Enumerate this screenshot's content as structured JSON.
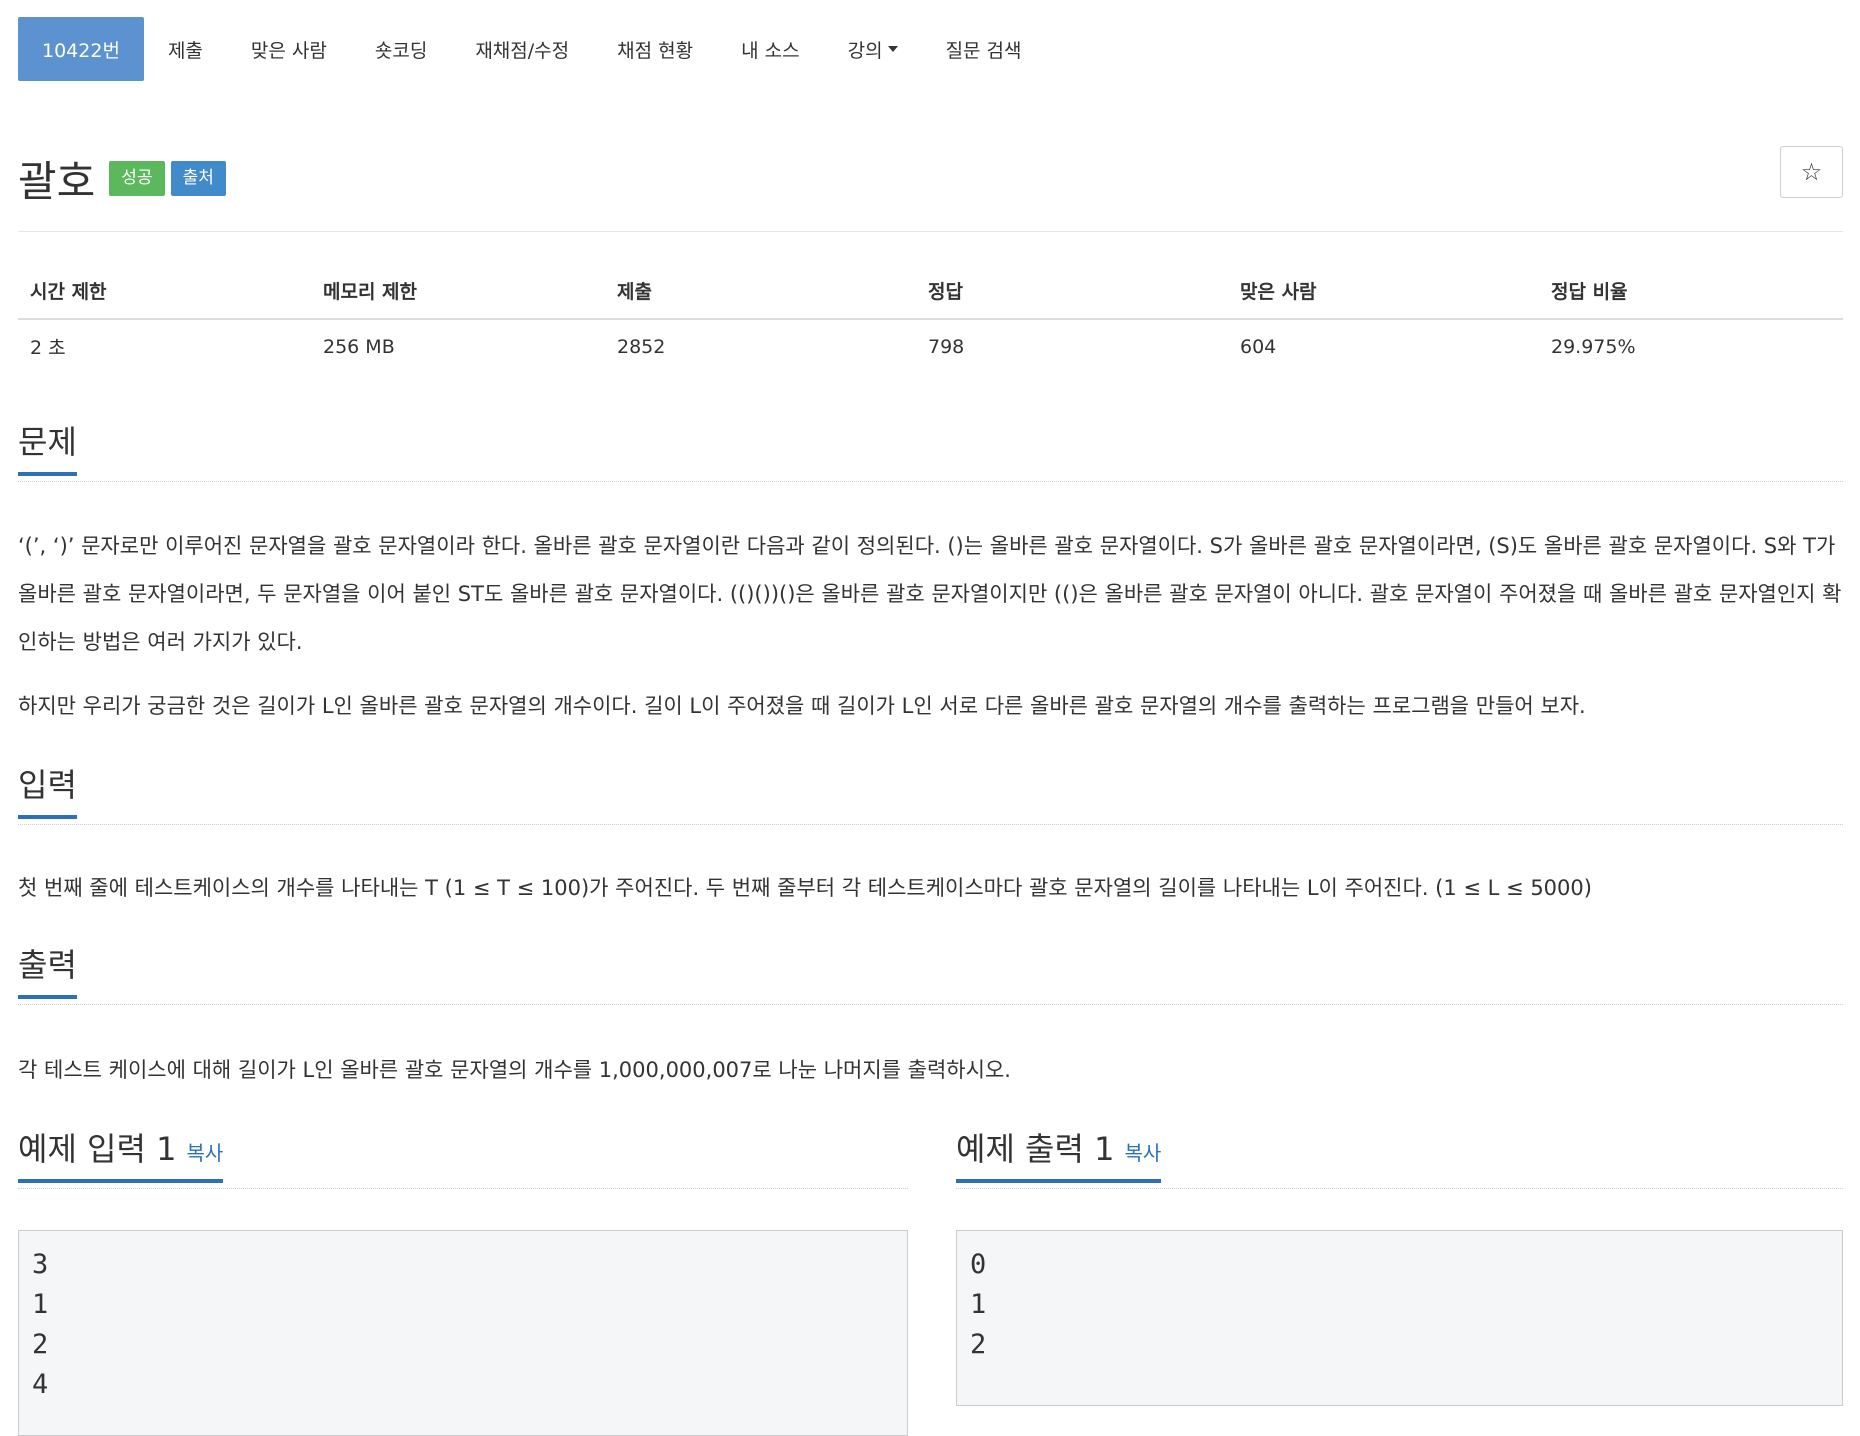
{
  "nav": {
    "items": [
      {
        "label": "10422번",
        "active": true
      },
      {
        "label": "제출"
      },
      {
        "label": "맞은 사람"
      },
      {
        "label": "숏코딩"
      },
      {
        "label": "재채점/수정"
      },
      {
        "label": "채점 현황"
      },
      {
        "label": "내 소스"
      },
      {
        "label": "강의",
        "dropdown": true
      },
      {
        "label": "질문 검색"
      }
    ]
  },
  "problem": {
    "title": "괄호",
    "badge_success": "성공",
    "badge_source": "출처",
    "star": "☆"
  },
  "info": {
    "headers": [
      "시간 제한",
      "메모리 제한",
      "제출",
      "정답",
      "맞은 사람",
      "정답 비율"
    ],
    "values": [
      "2 초",
      "256 MB",
      "2852",
      "798",
      "604",
      "29.975%"
    ]
  },
  "sections": {
    "description_title": "문제",
    "description_p1": "‘(’, ‘)’ 문자로만 이루어진 문자열을 괄호 문자열이라 한다. 올바른 괄호 문자열이란 다음과 같이 정의된다. ()는 올바른 괄호 문자열이다. S가 올바른 괄호 문자열이라면, (S)도 올바른 괄호 문자열이다. S와 T가 올바른 괄호 문자열이라면, 두 문자열을 이어 붙인 ST도 올바른 괄호 문자열이다. (()())()은 올바른 괄호 문자열이지만 (()은 올바른 괄호 문자열이 아니다. 괄호 문자열이 주어졌을 때 올바른 괄호 문자열인지 확인하는 방법은 여러 가지가 있다.",
    "description_p2": "하지만 우리가 궁금한 것은 길이가 L인 올바른 괄호 문자열의 개수이다. 길이 L이 주어졌을 때 길이가 L인 서로 다른 올바른 괄호 문자열의 개수를 출력하는 프로그램을 만들어 보자.",
    "input_title": "입력",
    "input_text": "첫 번째 줄에 테스트케이스의 개수를 나타내는 T (1 ≤ T ≤ 100)가 주어진다. 두 번째 줄부터 각 테스트케이스마다 괄호 문자열의 길이를 나타내는 L이 주어진다. (1 ≤ L ≤ 5000)",
    "output_title": "출력",
    "output_text": "각 테스트 케이스에 대해 길이가 L인 올바른 괄호 문자열의 개수를 1,000,000,007로 나눈 나머지를 출력하시오."
  },
  "examples": {
    "input_title": "예제 입력 1",
    "output_title": "예제 출력 1",
    "copy_label": "복사",
    "input_lines": [
      "3",
      "1",
      "2",
      "4"
    ],
    "output_lines": [
      "0",
      "1",
      "2"
    ]
  }
}
